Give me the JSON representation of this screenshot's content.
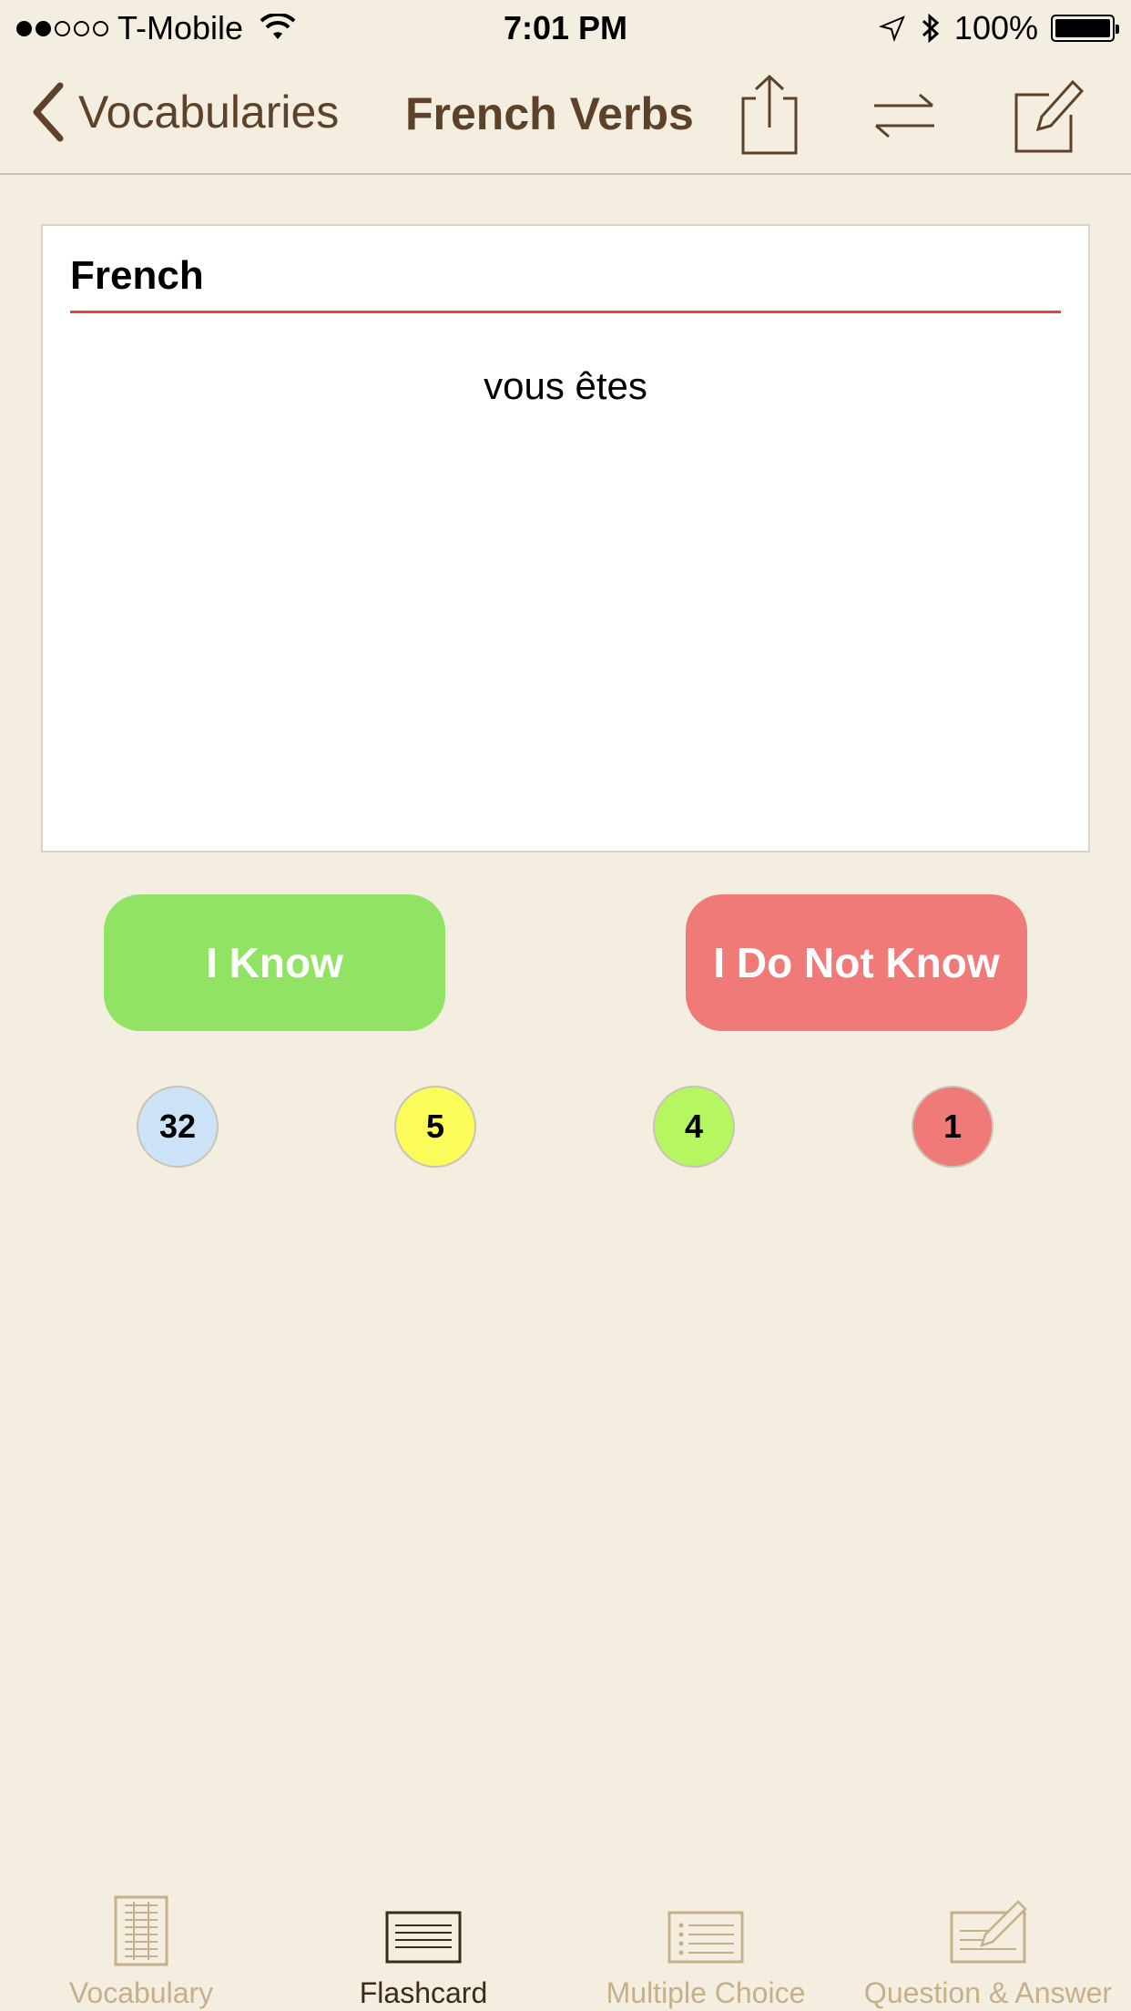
{
  "status": {
    "carrier": "T-Mobile",
    "time": "7:01 PM",
    "battery": "100%",
    "signal_bars_filled": 2,
    "signal_bars_total": 5
  },
  "nav": {
    "back_label": "Vocabularies",
    "title": "French Verbs"
  },
  "card": {
    "language": "French",
    "word": "vous êtes"
  },
  "buttons": {
    "know": "I Know",
    "not_know": "I Do Not Know"
  },
  "counters": [
    {
      "value": "32",
      "color": "#cce3f7"
    },
    {
      "value": "5",
      "color": "#fbfb59"
    },
    {
      "value": "4",
      "color": "#b5f661"
    },
    {
      "value": "1",
      "color": "#ef7a77"
    }
  ],
  "tabs": [
    {
      "label": "Vocabulary",
      "icon": "book-icon",
      "active": false
    },
    {
      "label": "Flashcard",
      "icon": "flashcard-icon",
      "active": true
    },
    {
      "label": "Multiple Choice",
      "icon": "list-icon",
      "active": false
    },
    {
      "label": "Question & Answer",
      "icon": "edit-card-icon",
      "active": false
    }
  ],
  "colors": {
    "background": "#f3eedf",
    "accent_brown": "#5e4129",
    "know_green": "#90e363",
    "not_know_red": "#ef7a77",
    "card_rule_red": "#e2453e",
    "tab_inactive": "#c6b08a"
  }
}
